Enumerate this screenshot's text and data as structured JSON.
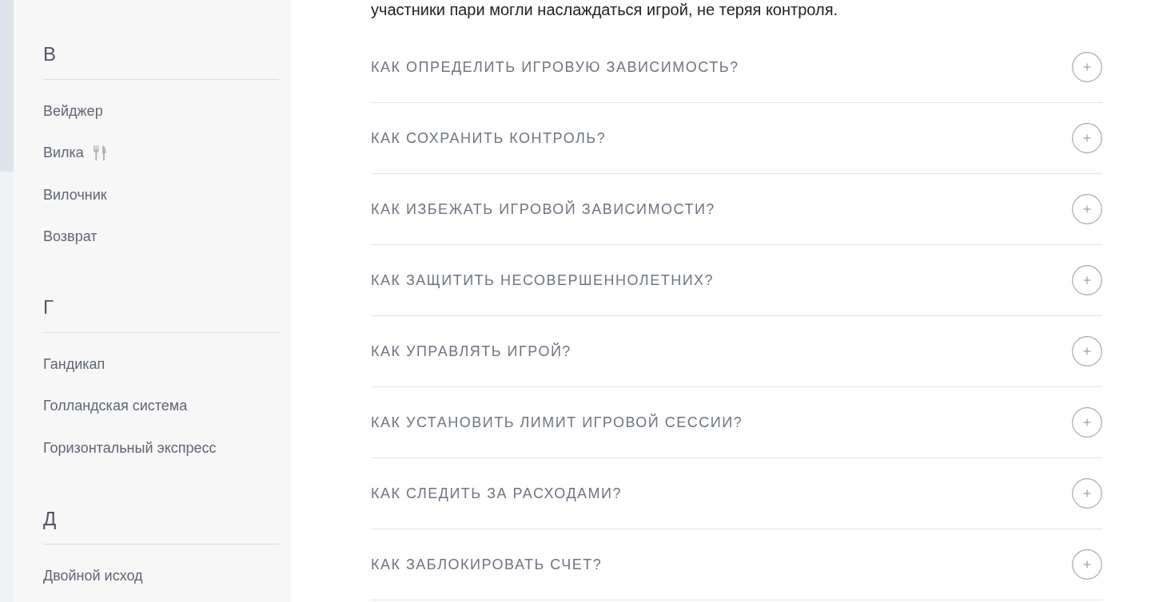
{
  "sidebar": {
    "sections": [
      {
        "letter": "В",
        "entries": [
          {
            "label": "Вейджер",
            "kind": "text"
          },
          {
            "label": "Вилка",
            "kind": "icon"
          },
          {
            "label": "Вилочник",
            "kind": "text"
          },
          {
            "label": "Возврат",
            "kind": "text"
          }
        ]
      },
      {
        "letter": "Г",
        "entries": [
          {
            "label": "Гандикап",
            "kind": "text"
          },
          {
            "label": "Голландская система",
            "kind": "text"
          },
          {
            "label": "Горизонтальный экспресс",
            "kind": "text"
          }
        ]
      },
      {
        "letter": "Д",
        "entries": [
          {
            "label": "Двойной исход",
            "kind": "text"
          }
        ]
      }
    ]
  },
  "article": {
    "paragraph_end": "участники пари могли наслаждаться игрой, не теряя контроля."
  },
  "faq": [
    {
      "question": "КАК ОПРЕДЕЛИТЬ ИГРОВУЮ ЗАВИСИМОСТЬ?",
      "expanded": false
    },
    {
      "question": "КАК СОХРАНИТЬ КОНТРОЛЬ?",
      "expanded": false
    },
    {
      "question": "КАК ИЗБЕЖАТЬ ИГРОВОЙ ЗАВИСИМОСТИ?",
      "expanded": false
    },
    {
      "question": "КАК ЗАЩИТИТЬ НЕСОВЕРШЕННОЛЕТНИХ?",
      "expanded": false
    },
    {
      "question": "КАК УПРАВЛЯТЬ ИГРОЙ?",
      "expanded": false
    },
    {
      "question": "КАК УСТАНОВИТЬ ЛИМИТ ИГРОВОЙ СЕССИИ?",
      "expanded": false
    },
    {
      "question": "КАК СЛЕДИТЬ ЗА РАСХОДАМИ?",
      "expanded": false
    },
    {
      "question": "КАК ЗАБЛОКИРОВАТЬ СЧЕТ?",
      "expanded": false
    }
  ]
}
